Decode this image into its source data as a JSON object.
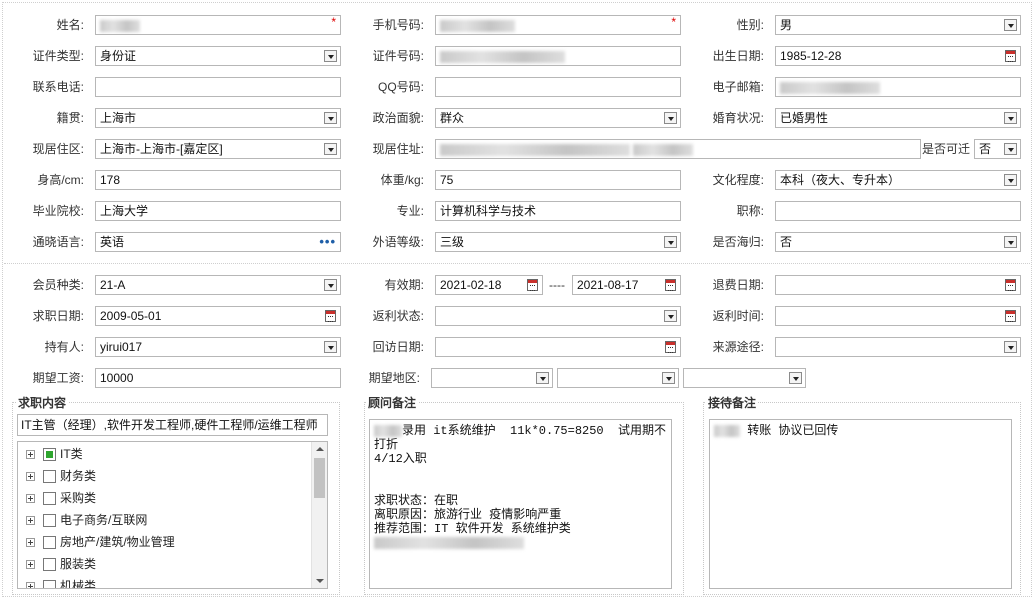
{
  "basic": {
    "name": {
      "label": "姓名:",
      "value": ""
    },
    "phone": {
      "label": "手机号码:",
      "value": ""
    },
    "gender": {
      "label": "性别:",
      "value": "男"
    },
    "id_type": {
      "label": "证件类型:",
      "value": "身份证"
    },
    "id_no": {
      "label": "证件号码:",
      "value": ""
    },
    "birth": {
      "label": "出生日期:",
      "value": "1985-12-28"
    },
    "contact": {
      "label": "联系电话:",
      "value": ""
    },
    "qq": {
      "label": "QQ号码:",
      "value": ""
    },
    "email": {
      "label": "电子邮箱:",
      "value": ""
    },
    "native": {
      "label": "籍贯:",
      "value": "上海市"
    },
    "political": {
      "label": "政治面貌:",
      "value": "群众"
    },
    "marital": {
      "label": "婚育状况:",
      "value": "已婚男性"
    },
    "residence": {
      "label": "现居住区:",
      "value": "上海市-上海市-[嘉定区]"
    },
    "address": {
      "label": "现居住址:",
      "value": ""
    },
    "relocate": {
      "label": "是否可迁",
      "value": "否"
    },
    "height": {
      "label": "身高/cm:",
      "value": "178"
    },
    "weight": {
      "label": "体重/kg:",
      "value": "75"
    },
    "education": {
      "label": "文化程度:",
      "value": "本科（夜大、专升本）"
    },
    "school": {
      "label": "毕业院校:",
      "value": "上海大学"
    },
    "major": {
      "label": "专业:",
      "value": "计算机科学与技术"
    },
    "title": {
      "label": "职称:",
      "value": ""
    },
    "language": {
      "label": "通晓语言:",
      "value": "英语"
    },
    "lang_level": {
      "label": "外语等级:",
      "value": "三级"
    },
    "returnee": {
      "label": "是否海归:",
      "value": "否"
    }
  },
  "member": {
    "type": {
      "label": "会员种类:",
      "value": "21-A"
    },
    "valid": {
      "label": "有效期:",
      "from": "2021-02-18",
      "sep": "----",
      "to": "2021-08-17"
    },
    "refund_date": {
      "label": "退费日期:",
      "value": ""
    },
    "job_date": {
      "label": "求职日期:",
      "value": "2009-05-01"
    },
    "rebate_status": {
      "label": "返利状态:",
      "value": ""
    },
    "rebate_time": {
      "label": "返利时间:",
      "value": ""
    },
    "holder": {
      "label": "持有人:",
      "value": "yirui017"
    },
    "visit_date": {
      "label": "回访日期:",
      "value": ""
    },
    "source": {
      "label": "来源途径:",
      "value": ""
    },
    "salary": {
      "label": "期望工资:",
      "value": "10000"
    },
    "region": {
      "label": "期望地区:",
      "values": [
        "",
        "",
        ""
      ]
    }
  },
  "job_panel": {
    "title": "求职内容",
    "summary": "IT主管（经理）,软件开发工程师,硬件工程师/运维工程师",
    "items": [
      {
        "label": "IT类",
        "checked": true
      },
      {
        "label": "财务类",
        "checked": false
      },
      {
        "label": "采购类",
        "checked": false
      },
      {
        "label": "电子商务/互联网",
        "checked": false
      },
      {
        "label": "房地产/建筑/物业管理",
        "checked": false
      },
      {
        "label": "服装类",
        "checked": false
      },
      {
        "label": "机械类",
        "checked": false
      }
    ]
  },
  "advisor_panel": {
    "title": "顾问备注",
    "lines": [
      "录用 it系统维护  11k*0.75=8250  试用期不打折",
      "4/12入职",
      "",
      "",
      "求职状态：在职",
      "离职原因：旅游行业 疫情影响严重",
      "推荐范围：IT 软件开发 系统维护类",
      ""
    ]
  },
  "reception_panel": {
    "title": "接待备注",
    "text": "转账 协议已回传"
  },
  "colors": {
    "checked": "#2ea52e",
    "required": "#dd0000",
    "dots": "#1f5fa8"
  }
}
